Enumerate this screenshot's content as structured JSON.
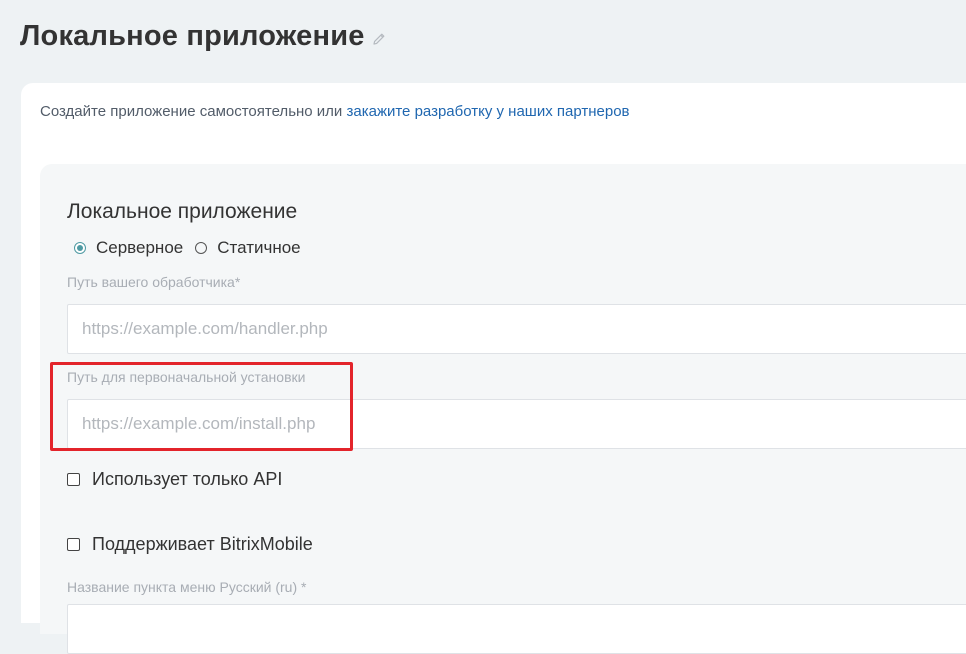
{
  "page": {
    "title": "Локальное приложение"
  },
  "intro": {
    "text": "Создайте приложение самостоятельно или ",
    "link": "закажите разработку у наших партнеров"
  },
  "form": {
    "section_title": "Локальное приложение",
    "app_type": {
      "options": [
        "Серверное",
        "Статичное"
      ],
      "selected": "Серверное"
    },
    "handler": {
      "label": "Путь вашего обработчика*",
      "placeholder": "https://example.com/handler.php",
      "value": ""
    },
    "install": {
      "label": "Путь для первоначальной установки",
      "placeholder": "https://example.com/install.php",
      "value": ""
    },
    "api_only": {
      "label": "Использует только API",
      "checked": false
    },
    "bitrix_mobile": {
      "label": "Поддерживает BitrixMobile",
      "checked": false
    },
    "menu_name": {
      "label": "Название пункта меню Русский (ru) *"
    }
  },
  "colors": {
    "link": "#2067b0",
    "radio_accent": "#4f9aa3",
    "highlight": "#e3242b"
  }
}
